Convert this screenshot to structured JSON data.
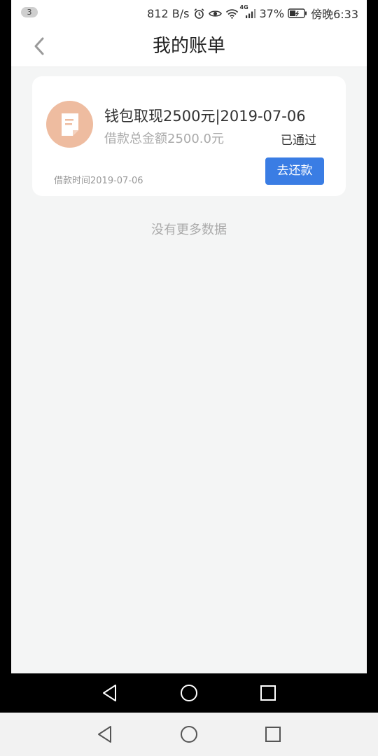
{
  "status_bar": {
    "notification_count": "3",
    "network_speed": "812 B/s",
    "battery_percent": "37%",
    "time": "傍晚6:33",
    "network_type": "4G",
    "icons": [
      "alarm-icon",
      "eye-icon",
      "wifi-icon",
      "signal-icon",
      "battery-icon"
    ]
  },
  "header": {
    "title": "我的账单",
    "back_icon": "chevron-left-icon"
  },
  "bill": {
    "title": "钱包取现2500元|2019-07-06",
    "total_amount": "借款总金额2500.0元",
    "status": "已通过",
    "loan_time": "借款时间2019-07-06",
    "repay_button": "去还款",
    "icon": "document-icon",
    "icon_color": "#eebca0"
  },
  "list_footer": "没有更多数据",
  "colors": {
    "accent": "#3a7de4",
    "background": "#f4f5f5"
  },
  "nav": {
    "buttons": [
      "back-triangle-icon",
      "home-circle-icon",
      "recents-square-icon"
    ]
  }
}
